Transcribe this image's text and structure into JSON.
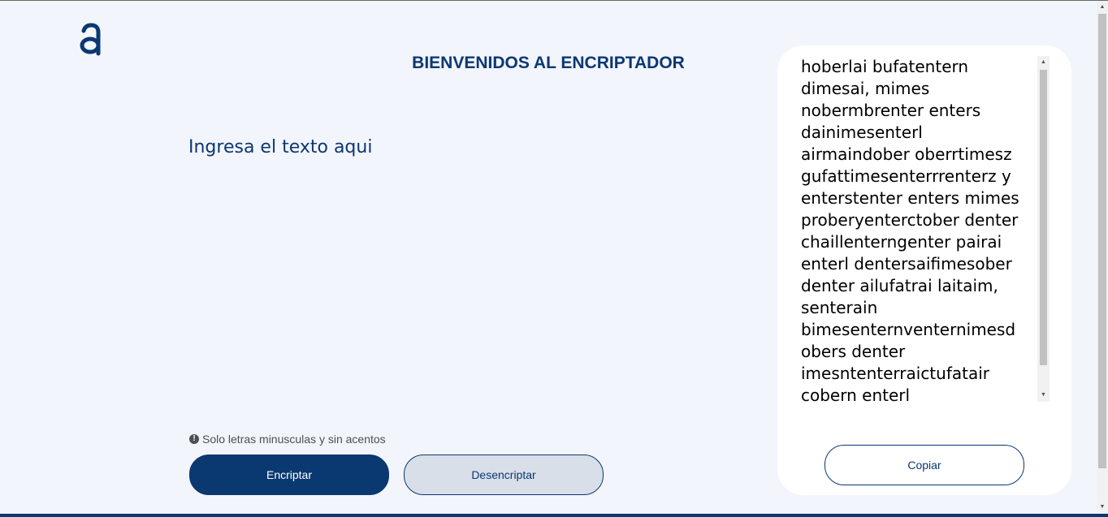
{
  "header": {
    "logo_icon": "logo-a-icon",
    "title": "BIENVENIDOS AL ENCRIPTADOR"
  },
  "input": {
    "placeholder": "Ingresa el texto aqui",
    "value": ""
  },
  "hint": {
    "icon": "exclamation-circle-icon",
    "text": "Solo letras minusculas y sin acentos"
  },
  "actions": {
    "encrypt_label": "Encriptar",
    "decrypt_label": "Desencriptar"
  },
  "output": {
    "lines": [
      "hoberlai bufatentern",
      "dimesai, mimes",
      "nobermbrenter enters",
      "dainimesenterl",
      "airmaindober oberrtimesz",
      "gufattimesenterrrenterz y",
      "enterstenter enters mimes",
      "proberyenterctober denter",
      "chaillenterngenter pairai",
      "enterl dentersaifimesober",
      "denter ailufatrai laitaim,",
      "senterain",
      "bimesenternventernimesd",
      "obers denter",
      "imesntenterraictufatair",
      "cobern enterl"
    ],
    "copy_label": "Copiar"
  },
  "colors": {
    "primary": "#0a3871",
    "background": "#f3f5fc",
    "card": "#ffffff",
    "secondary_button": "#d8dfe8",
    "hint": "#495057"
  }
}
